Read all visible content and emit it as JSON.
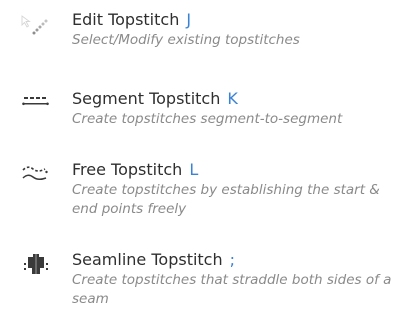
{
  "tools": [
    {
      "title": "Edit Topstitch",
      "shortcut": "J",
      "description": "Select/Modify existing topstitches",
      "icon": "edit-topstitch-icon"
    },
    {
      "title": "Segment Topstitch",
      "shortcut": "K",
      "description": "Create topstitches segment-to-segment",
      "icon": "segment-topstitch-icon"
    },
    {
      "title": "Free Topstitch",
      "shortcut": "L",
      "description": "Create topstitches by establishing the start & end points freely",
      "icon": "free-topstitch-icon"
    },
    {
      "title": "Seamline Topstitch",
      "shortcut": ";",
      "description": "Create topstitches that straddle both sides of a seam",
      "icon": "seamline-topstitch-icon"
    }
  ],
  "colors": {
    "shortcut_key": "#3b82d6",
    "title_text": "#2f2f2f",
    "description_text": "#8a8a8a",
    "icon_dark": "#3a3a3a",
    "icon_light": "#bdbdbd"
  }
}
